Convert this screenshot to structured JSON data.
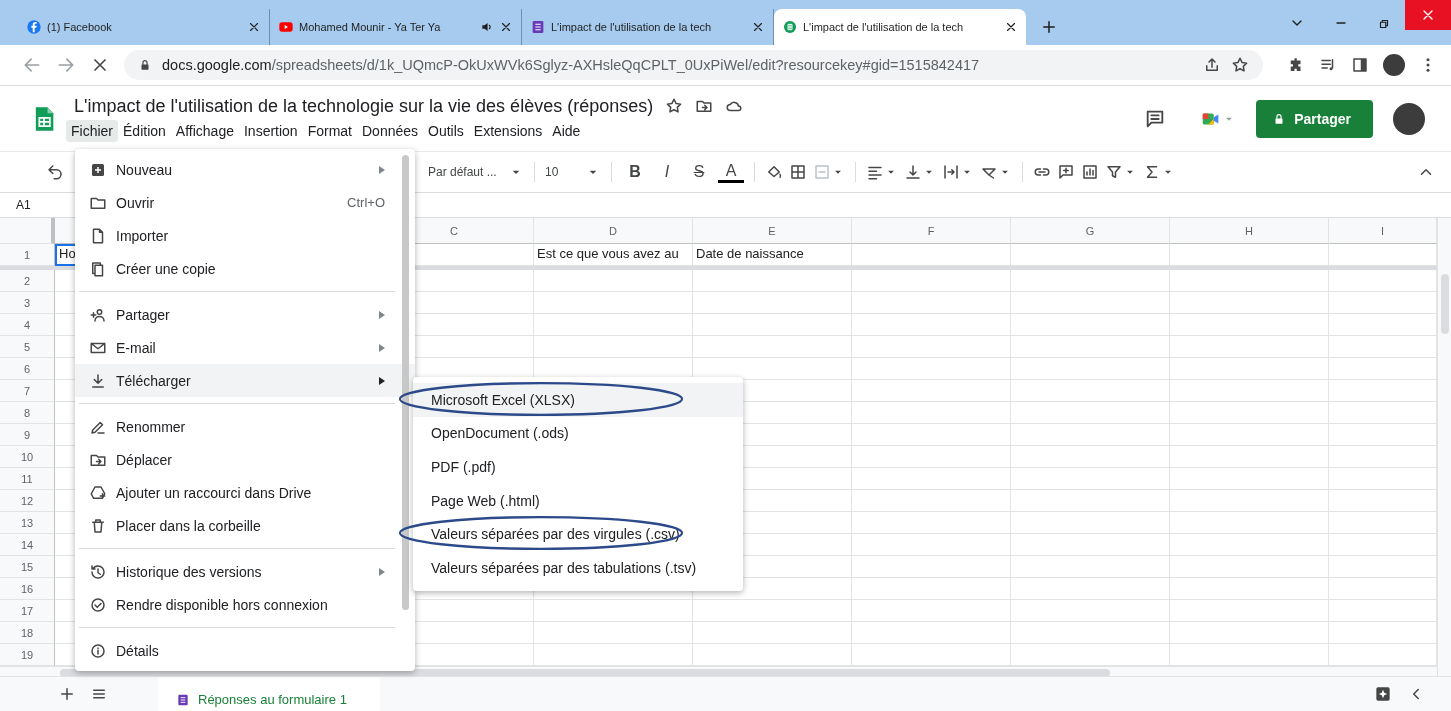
{
  "browser_tabs": [
    {
      "title": "(1) Facebook",
      "selected": false,
      "audio": false
    },
    {
      "title": "Mohamed Mounir - Ya Ter Ya",
      "selected": false,
      "audio": true
    },
    {
      "title": "L'impact de l'utilisation de la tech",
      "selected": false,
      "audio": false
    },
    {
      "title": "L'impact de l'utilisation de la tech",
      "selected": true,
      "audio": false
    }
  ],
  "address_bar": {
    "host": "docs.google.com",
    "path": "/spreadsheets/d/1k_UQmcP-OkUxWVk6Sglyz-AXHsleQqCPLT_0UxPiWel/edit?resourcekey#gid=1515842417"
  },
  "document": {
    "title": "L'impact de l'utilisation de la technologie sur la vie des élèves (réponses)",
    "menu": [
      {
        "label": "Fichier",
        "selected": true
      },
      {
        "label": "Édition",
        "selected": false
      },
      {
        "label": "Affichage",
        "selected": false
      },
      {
        "label": "Insertion",
        "selected": false
      },
      {
        "label": "Format",
        "selected": false
      },
      {
        "label": "Données",
        "selected": false
      },
      {
        "label": "Outils",
        "selected": false
      },
      {
        "label": "Extensions",
        "selected": false
      },
      {
        "label": "Aide",
        "selected": false
      }
    ],
    "share_button": "Partager"
  },
  "toolbar": {
    "font": "Par défaut ...",
    "font_size": "10",
    "format_letters": [
      "B",
      "I",
      "S",
      "A"
    ]
  },
  "name_box": "A1",
  "columns": [
    "C",
    "D",
    "E",
    "F",
    "G",
    "H",
    "I"
  ],
  "row_1": {
    "number": "1",
    "a1": {
      "text": "Ho",
      "selected": true
    },
    "d1": "Est ce que vous avez au",
    "e1": "Date de naissance"
  },
  "row_numbers": [
    "2",
    "3",
    "4",
    "5",
    "6",
    "7",
    "8",
    "9",
    "10",
    "11",
    "12",
    "13",
    "14",
    "15",
    "16",
    "17",
    "18",
    "19"
  ],
  "sheet_tab": "Réponses au formulaire 1",
  "file_menu": [
    [
      {
        "label": "Nouveau",
        "submenu": true,
        "selected": false
      },
      {
        "label": "Ouvrir",
        "shortcut": "Ctrl+O",
        "submenu": false,
        "selected": false
      },
      {
        "label": "Importer",
        "submenu": false,
        "selected": false
      },
      {
        "label": "Créer une copie",
        "submenu": false,
        "selected": false
      }
    ],
    [
      {
        "label": "Partager",
        "submenu": true,
        "selected": false
      },
      {
        "label": "E-mail",
        "submenu": true,
        "selected": false
      },
      {
        "label": "Télécharger",
        "submenu": true,
        "selected": true
      }
    ],
    [
      {
        "label": "Renommer",
        "submenu": false,
        "selected": false
      },
      {
        "label": "Déplacer",
        "submenu": false,
        "selected": false
      },
      {
        "label": "Ajouter un raccourci dans Drive",
        "submenu": false,
        "selected": false
      },
      {
        "label": "Placer dans la corbeille",
        "submenu": false,
        "selected": false
      }
    ],
    [
      {
        "label": "Historique des versions",
        "submenu": true,
        "selected": false
      },
      {
        "label": "Rendre disponible hors connexion",
        "submenu": false,
        "selected": false
      }
    ],
    [
      {
        "label": "Détails",
        "submenu": false,
        "selected": false
      }
    ]
  ],
  "download_submenu": [
    {
      "label": "Microsoft Excel (XLSX)",
      "selected": true,
      "circled": true
    },
    {
      "label": "OpenDocument (.ods)",
      "selected": false,
      "circled": false
    },
    {
      "label": "PDF (.pdf)",
      "selected": false,
      "circled": false
    },
    {
      "label": "Page Web (.html)",
      "selected": false,
      "circled": false
    },
    {
      "label": "Valeurs séparées par des virgules (.csv)",
      "selected": false,
      "circled": true
    },
    {
      "label": "Valeurs séparées par des tabulations (.tsv)",
      "selected": false,
      "circled": false
    }
  ]
}
